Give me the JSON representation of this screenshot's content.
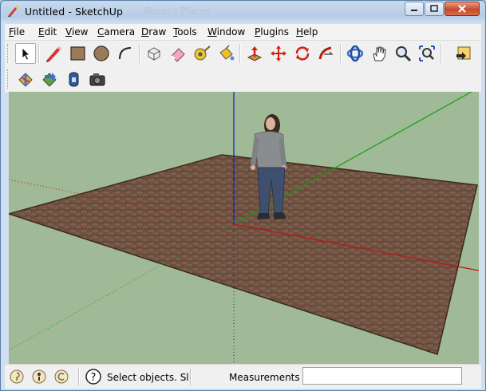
{
  "window": {
    "title": "Untitled - SketchUp",
    "background_title": "Recent Places",
    "controls": [
      "minimize",
      "maximize",
      "close"
    ]
  },
  "menu": {
    "items": [
      {
        "label": "File",
        "mnemonic": "F",
        "rest": "ile"
      },
      {
        "label": "Edit",
        "mnemonic": "E",
        "rest": "dit"
      },
      {
        "label": "View",
        "mnemonic": "V",
        "rest": "iew"
      },
      {
        "label": "Camera",
        "mnemonic": "C",
        "rest": "amera"
      },
      {
        "label": "Draw",
        "mnemonic": "D",
        "rest": "raw"
      },
      {
        "label": "Tools",
        "mnemonic": "T",
        "rest": "ools"
      },
      {
        "label": "Window",
        "mnemonic": "W",
        "rest": "indow"
      },
      {
        "label": "Plugins",
        "mnemonic": "P",
        "rest": "lugins"
      },
      {
        "label": "Help",
        "mnemonic": "H",
        "rest": "elp"
      }
    ]
  },
  "toolbar": {
    "row1": [
      "select-tool",
      "line-tool",
      "rectangle-tool",
      "circle-tool",
      "arc-tool",
      "make-component-tool",
      "eraser-tool",
      "tape-measure-tool",
      "paint-bucket-tool",
      "push-pull-tool",
      "move-tool",
      "rotate-tool",
      "follow-me-tool",
      "orbit-tool",
      "pan-tool",
      "zoom-tool",
      "zoom-extents-tool",
      "previous-view-tool"
    ],
    "row2": [
      "get-models-tool",
      "share-model-tool",
      "share-component-tool",
      "photo-textures-tool"
    ],
    "active": "select-tool"
  },
  "viewport": {
    "background": "#a0b996",
    "axis_colors": {
      "red": "#c81010",
      "green": "#12a012",
      "blue": "#1020c0"
    },
    "ground_texture": "wood-parquet",
    "figure": "scale-figure-person"
  },
  "status": {
    "icons": [
      "geo-location-icon",
      "credits-icon",
      "sign-in-icon"
    ],
    "help_icon": "help-question-icon",
    "message": "Select objects. Sl",
    "measurements_label": "Measurements",
    "measurements_value": ""
  }
}
